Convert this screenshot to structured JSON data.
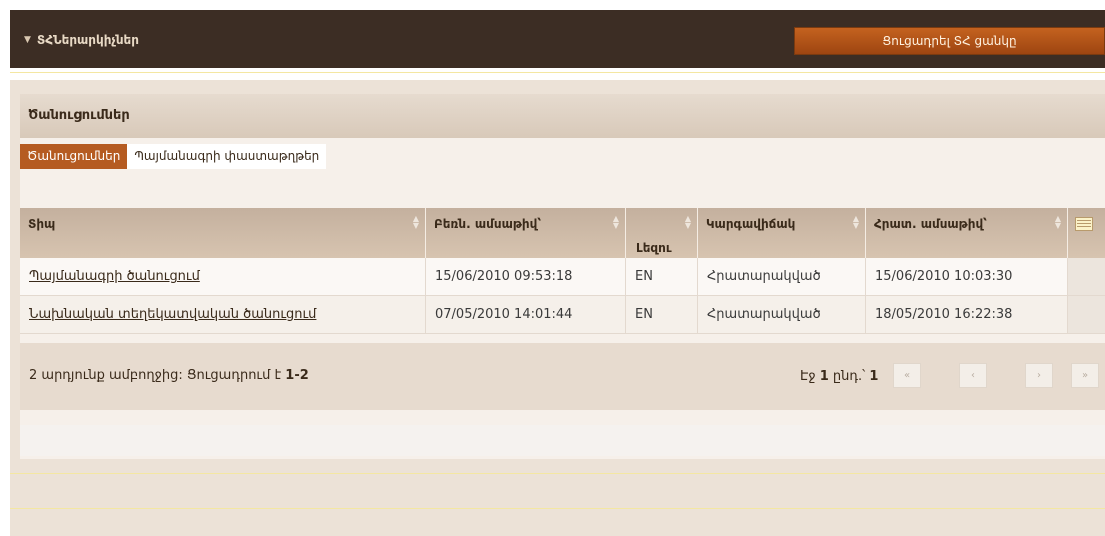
{
  "header": {
    "title": "ՏՀՆերարկիչներ",
    "show_list_button": "Ցուցադրել ՏՀ ցանկը"
  },
  "panel": {
    "title": "Ծանուցումներ"
  },
  "tabs": [
    {
      "label": "Ծանուցումներ",
      "active": true
    },
    {
      "label": "Պայմանագրի փաստաթղթեր",
      "active": false
    }
  ],
  "table": {
    "columns": [
      "Տիպ",
      "Բեռն. ամսաթիվ՝",
      "Լեզու",
      "Կարգավիճակ",
      "Հրատ. ամսաթիվ՝"
    ],
    "rows": [
      [
        "Պայմանագրի ծանուցում",
        "15/06/2010 09:53:18",
        "EN",
        "Հրատարակված",
        "15/06/2010 10:03:30"
      ],
      [
        "Նախնական տեղեկատվական ծանուցում",
        "07/05/2010 14:01:44",
        "EN",
        "Հրատարակված",
        "18/05/2010 16:22:38"
      ]
    ]
  },
  "pager": {
    "summary_prefix": "2 արդյունք ամբողջից:   Ցուցադրում է ",
    "summary_range": "1-2",
    "page_prefix": "Էջ ",
    "page_current": "1",
    "page_mid": " ընդ.՝ ",
    "page_total": "1",
    "buttons": [
      "«",
      "‹",
      "›",
      "»"
    ]
  },
  "colors": {
    "accent": "#b55b21",
    "topbar": "#3c2d24"
  }
}
